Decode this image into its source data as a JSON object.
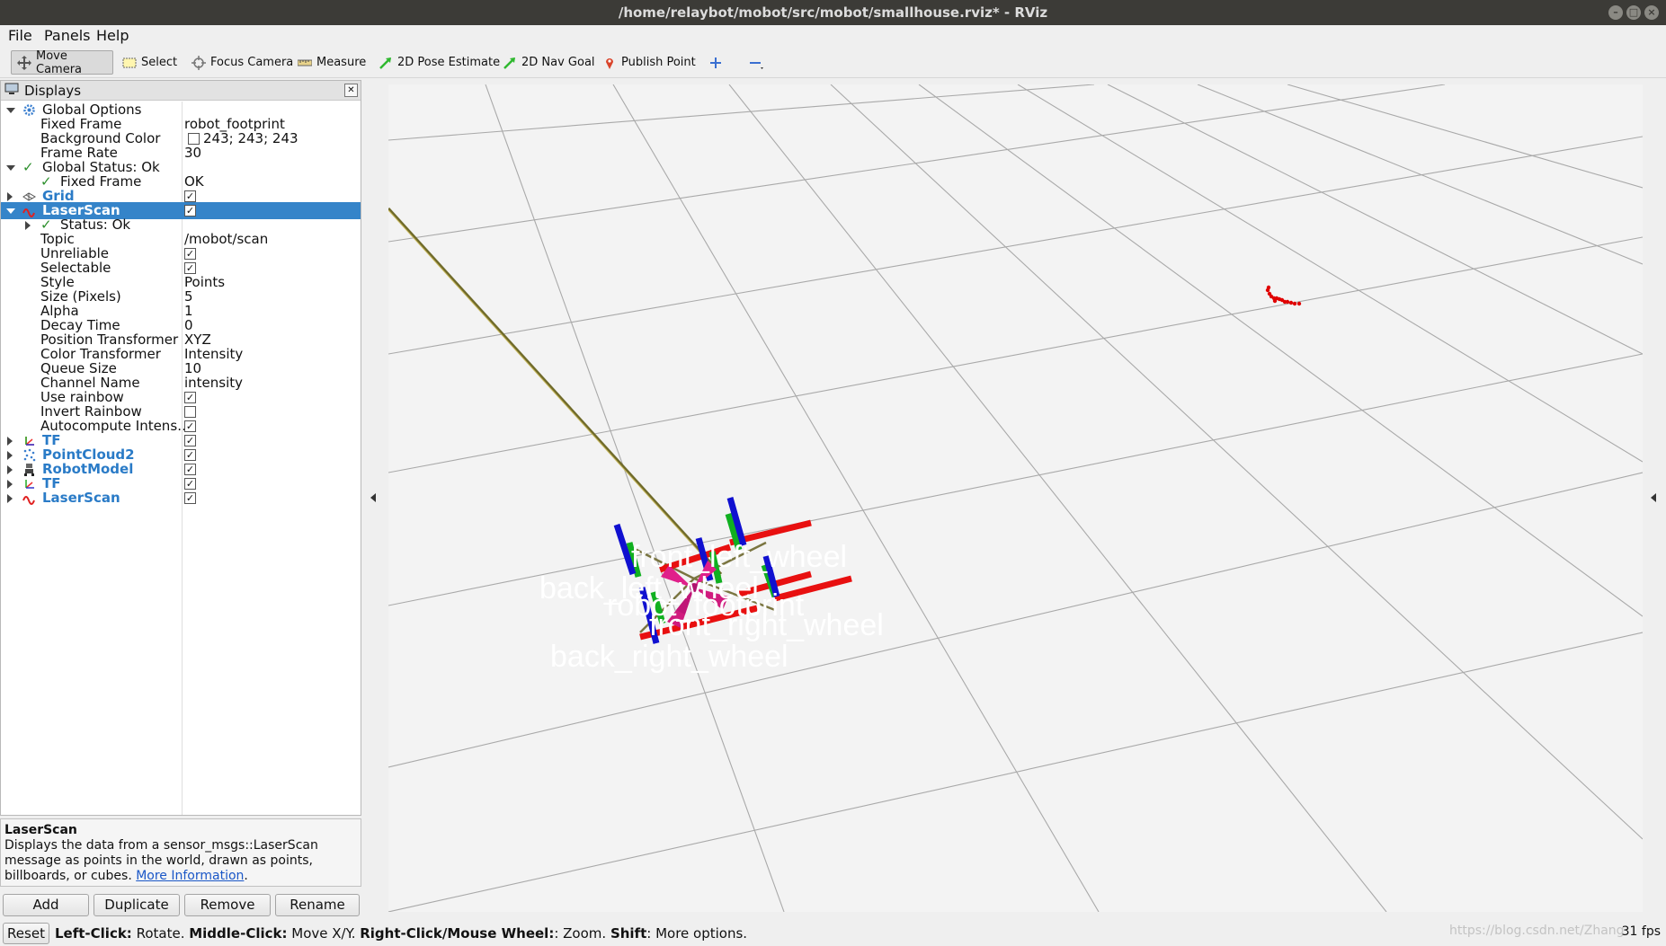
{
  "window": {
    "title": "/home/relaybot/mobot/src/mobot/smallhouse.rviz* - RViz"
  },
  "menu": [
    "File",
    "Panels",
    "Help"
  ],
  "toolbar": {
    "move_camera": "Move Camera",
    "select": "Select",
    "focus_camera": "Focus Camera",
    "measure": "Measure",
    "pose_estimate": "2D Pose Estimate",
    "nav_goal": "2D Nav Goal",
    "publish_point": "Publish Point"
  },
  "displays": {
    "title": "Displays",
    "global_options": "Global Options",
    "fixed_frame_label": "Fixed Frame",
    "fixed_frame_value": "robot_footprint",
    "background_color_label": "Background Color",
    "background_color_value": "243; 243; 243",
    "frame_rate_label": "Frame Rate",
    "frame_rate_value": "30",
    "global_status": "Global Status: Ok",
    "fixed_frame_status_label": "Fixed Frame",
    "fixed_frame_status_value": "OK",
    "grid": "Grid",
    "laserscan": "LaserScan",
    "status_ok": "Status: Ok",
    "topic_label": "Topic",
    "topic_value": "/mobot/scan",
    "unreliable": "Unreliable",
    "selectable": "Selectable",
    "style_label": "Style",
    "style_value": "Points",
    "size_label": "Size (Pixels)",
    "size_value": "5",
    "alpha_label": "Alpha",
    "alpha_value": "1",
    "decay_label": "Decay Time",
    "decay_value": "0",
    "pos_tf_label": "Position Transformer",
    "pos_tf_value": "XYZ",
    "color_tf_label": "Color Transformer",
    "color_tf_value": "Intensity",
    "queue_label": "Queue Size",
    "queue_value": "10",
    "channel_label": "Channel Name",
    "channel_value": "intensity",
    "use_rainbow": "Use rainbow",
    "invert_rainbow": "Invert Rainbow",
    "autocompute": "Autocompute Intens…",
    "tf1": "TF",
    "pointcloud2": "PointCloud2",
    "robotmodel": "RobotModel",
    "tf2": "TF",
    "laserscan2": "LaserScan"
  },
  "description": {
    "title": "LaserScan",
    "text": "Displays the data from a sensor_msgs::LaserScan message as points in the world, drawn as points, billboards, or cubes.",
    "link": "More Information",
    "end": "."
  },
  "buttons": {
    "add": "Add",
    "duplicate": "Duplicate",
    "remove": "Remove",
    "rename": "Rename"
  },
  "viewport": {
    "labels": {
      "front_left": "front_left_wheel",
      "back_left": "back_left_wheel",
      "robot_footprint": "robot_footprint",
      "front_right": "front_right_wheel",
      "back_right": "back_right_wheel"
    },
    "colors": {
      "background": "#f3f3f3",
      "grid": "#a0a0a0",
      "scan": "#e00000"
    }
  },
  "status": {
    "reset": "Reset",
    "left_click": "Left-Click:",
    "left_click_text": " Rotate. ",
    "middle_click": "Middle-Click:",
    "middle_click_text": " Move X/Y. ",
    "right_click": "Right-Click/Mouse Wheel:",
    "right_click_text": ": Zoom. ",
    "shift": "Shift",
    "shift_text": ": More options.",
    "fps": "31 fps",
    "watermark": "https://blog.csdn.net/Zhang"
  }
}
